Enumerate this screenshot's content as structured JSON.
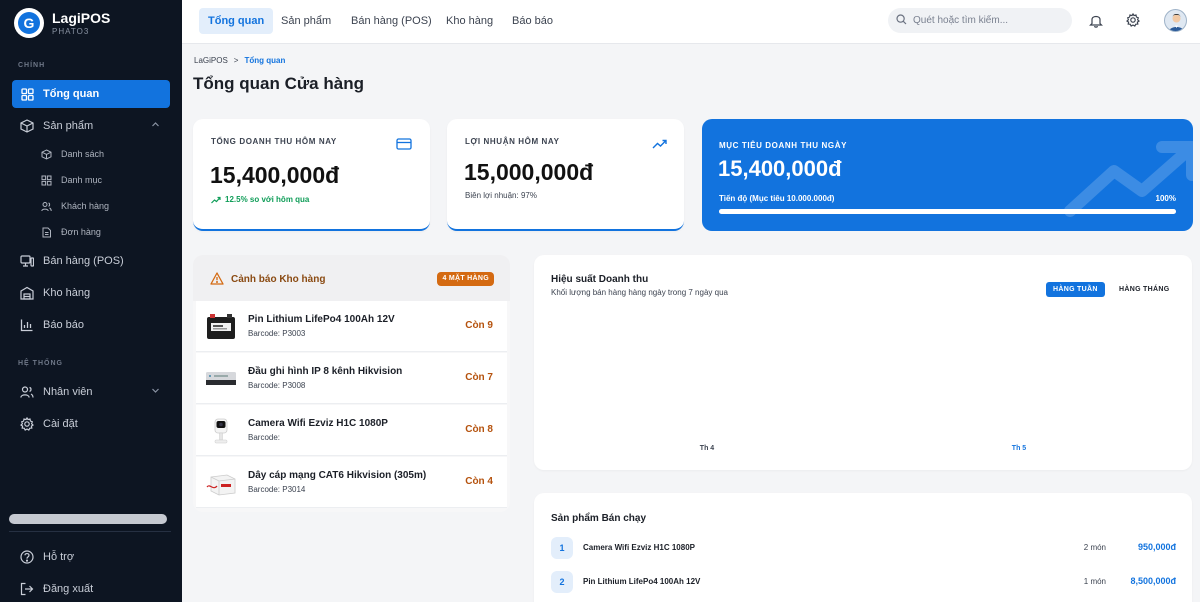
{
  "brand": {
    "name": "LagiPOS",
    "sub": "PHATO3",
    "logo_letter": "G"
  },
  "sidebar": {
    "section_main": "CHÍNH",
    "section_system": "HỆ THỐNG",
    "items": [
      {
        "label": "Tổng quan",
        "icon": "dashboard-icon"
      },
      {
        "label": "Sản phẩm",
        "icon": "box-icon"
      },
      {
        "label": "Bán hàng (POS)",
        "icon": "pos-icon"
      },
      {
        "label": "Kho hàng",
        "icon": "warehouse-icon"
      },
      {
        "label": "Báo báo",
        "icon": "report-icon"
      },
      {
        "label": "Nhân viên",
        "icon": "users-icon"
      },
      {
        "label": "Cài đặt",
        "icon": "gear-icon"
      }
    ],
    "sub_items": [
      {
        "label": "Danh sách"
      },
      {
        "label": "Danh mục"
      },
      {
        "label": "Khách hàng"
      },
      {
        "label": "Đơn hàng"
      }
    ],
    "footer": [
      {
        "label": "Hỗ trợ"
      },
      {
        "label": "Đăng xuất"
      }
    ]
  },
  "header": {
    "tabs": [
      "Tổng quan",
      "Sản phẩm",
      "Bán hàng (POS)",
      "Kho hàng",
      "Báo báo"
    ],
    "search_placeholder": "Quét hoặc tìm kiếm..."
  },
  "breadcrumb": {
    "root": "LaGiPOS",
    "sep": ">",
    "current": "Tổng quan"
  },
  "page_title": "Tổng quan Cửa hàng",
  "stats": {
    "revenue": {
      "label": "TỔNG DOANH THU HÔM NAY",
      "value": "15,400,000đ",
      "sub": "12.5% so với hôm qua"
    },
    "profit": {
      "label": "LỢI NHUẬN HÔM NAY",
      "value": "15,000,000đ",
      "sub": "Biên lợi nhuận: 97%"
    }
  },
  "goal": {
    "label": "MỤC TIÊU DOANH THU NGÀY",
    "value": "15,400,000đ",
    "progress_label": "Tiến độ (Mục tiêu 10.000.000đ)",
    "progress_pct_text": "100%",
    "progress": 1.0
  },
  "stock_alert": {
    "title": "Cảnh báo Kho hàng",
    "badge": "4 MẶT HÀNG",
    "items": [
      {
        "name": "Pin Lithium LifePo4 100Ah 12V",
        "code": "Barcode: P3003",
        "qty": "Còn 9"
      },
      {
        "name": "Đầu ghi hình IP 8 kênh Hikvision",
        "code": "Barcode: P3008",
        "qty": "Còn 7"
      },
      {
        "name": "Camera Wifi Ezviz H1C 1080P",
        "code": "Barcode:",
        "qty": "Còn 8"
      },
      {
        "name": "Dây cáp mạng CAT6 Hikvision (305m)",
        "code": "Barcode: P3014",
        "qty": "Còn 4"
      }
    ]
  },
  "chart": {
    "title": "Hiệu suất Doanh thu",
    "subtitle": "Khối lượng bán hàng hàng ngày trong 7 ngày qua",
    "btn_week": "HÀNG TUẦN",
    "btn_month": "HÀNG THÁNG"
  },
  "chart_data": {
    "type": "bar",
    "categories": [
      "Th 4",
      "Th 5"
    ],
    "values": [
      0,
      0
    ],
    "highlight_color": "#1273de"
  },
  "best_sellers": {
    "title": "Sản phẩm Bán chạy",
    "items": [
      {
        "rank": "1",
        "name": "Camera Wifi Ezviz H1C 1080P",
        "count": "2 món",
        "amount": "950,000đ"
      },
      {
        "rank": "2",
        "name": "Pin Lithium LifePo4 100Ah 12V",
        "count": "1 món",
        "amount": "8,500,000đ"
      }
    ]
  },
  "colors": {
    "accent": "#1273de",
    "sidebar": "#0d1522",
    "warning": "#d46a12"
  }
}
